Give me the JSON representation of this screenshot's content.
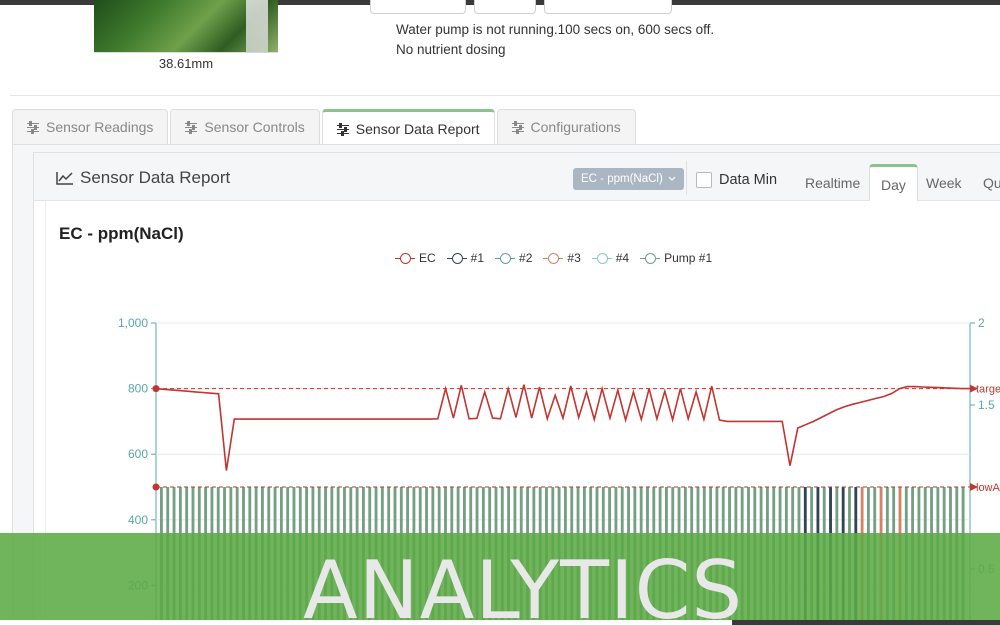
{
  "header": {
    "photo_caption": "38.61mm",
    "status_pump": "Water pump is not running.100 secs on, 600 secs off.",
    "status_dosing": "No nutrient dosing"
  },
  "tabs": [
    {
      "label": "Sensor Readings",
      "icon": "sliders-icon",
      "active": false
    },
    {
      "label": "Sensor Controls",
      "icon": "sliders-icon",
      "active": false
    },
    {
      "label": "Sensor Data Report",
      "icon": "sliders-icon",
      "active": true
    },
    {
      "label": "Configurations",
      "icon": "sliders-icon",
      "active": false
    }
  ],
  "panel": {
    "title": "Sensor Data Report",
    "title_icon": "line-chart-icon",
    "sensor_select": "EC - ppm(NaCl)",
    "data_min_label": "Data Min",
    "data_min_checked": false,
    "ranges": [
      "Realtime",
      "Day",
      "Week",
      "Qu"
    ],
    "active_range": "Day"
  },
  "chart_data": {
    "type": "line",
    "title": "EC - ppm(NaCl)",
    "legend": [
      {
        "name": "EC",
        "color": "#c23531"
      },
      {
        "name": "#1",
        "color": "#2f4554"
      },
      {
        "name": "#2",
        "color": "#61a0a8"
      },
      {
        "name": "#3",
        "color": "#d48265"
      },
      {
        "name": "#4",
        "color": "#91c7ae"
      },
      {
        "name": "Pump #1",
        "color": "#749f83"
      }
    ],
    "y_left": {
      "min": 0,
      "max": 1000,
      "ticks": [
        "1,000",
        "800",
        "600",
        "400",
        "200"
      ]
    },
    "y_right": {
      "min": 0,
      "max": 2,
      "ticks": [
        "2",
        "1.5",
        "0.5"
      ]
    },
    "mark_lines": [
      {
        "label": "targe",
        "value": 800,
        "color": "#c23531"
      },
      {
        "label": "lowA",
        "value": 500,
        "color": "#c23531"
      }
    ],
    "series": [
      {
        "name": "EC",
        "color": "#c23531",
        "values": [
          800,
          798,
          796,
          794,
          792,
          790,
          788,
          786,
          784,
          550,
          707,
          707,
          707,
          707,
          707,
          707,
          707,
          707,
          707,
          707,
          707,
          707,
          707,
          707,
          707,
          707,
          707,
          707,
          707,
          707,
          707,
          707,
          707,
          707,
          707,
          707,
          708,
          800,
          710,
          810,
          708,
          709,
          790,
          710,
          708,
          800,
          712,
          812,
          710,
          805,
          708,
          780,
          710,
          808,
          712,
          790,
          706,
          800,
          710,
          795,
          704,
          790,
          706,
          800,
          708,
          792,
          705,
          800,
          708,
          790,
          706,
          808,
          704,
          700,
          700,
          700,
          700,
          700,
          700,
          700,
          700,
          565,
          680,
          690,
          700,
          712,
          724,
          736,
          745,
          752,
          758,
          764,
          770,
          776,
          785,
          800,
          806,
          806,
          805,
          804,
          803,
          802,
          801,
          800,
          800
        ]
      },
      {
        "name": "Pump #1",
        "color": "#749f83",
        "pulses": 128
      }
    ]
  },
  "banner": {
    "text": "ANALYTICS"
  }
}
